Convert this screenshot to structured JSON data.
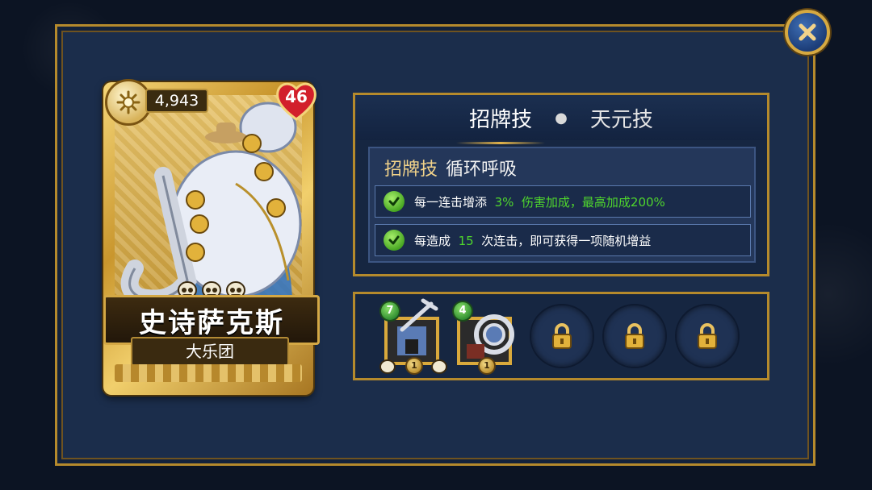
{
  "card": {
    "mana": "4,943",
    "health": "46",
    "name": "史诗萨克斯",
    "type": "大乐团",
    "skull_count": 3
  },
  "ability": {
    "tabs": [
      "招牌技",
      "天元技"
    ],
    "active_tab": "招牌技",
    "heading_label": "招牌技",
    "heading_name": "循环呼吸",
    "row1": {
      "pre": "每一连击增添",
      "num": "3%",
      "rest": "伤害加成，最高加成200%"
    },
    "row2": {
      "pre": "每造成",
      "num": "15",
      "rest": "次连击，即可获得一项随机增益"
    }
  },
  "items": [
    {
      "icon": "trumpet-icon",
      "level": "7",
      "count": "1"
    },
    {
      "icon": "french-horn-icon",
      "level": "4",
      "count": "1"
    }
  ],
  "locked_slots": 3,
  "colors": {
    "panel_bg": "#1b2d4b",
    "gold_border": "#b58a2c",
    "highlight_green": "#4fd62d",
    "heading_gold": "#f2d38a"
  }
}
